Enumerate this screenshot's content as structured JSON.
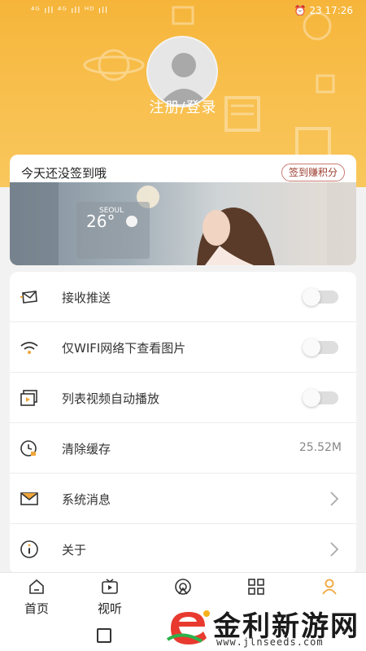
{
  "status": {
    "left": "⁴ᴳ ıll ⁴ᴳ ıll ᴴᴰ ıll",
    "right": "⏰ 23 17:26"
  },
  "profile": {
    "login_text": "注册/登录"
  },
  "checkin": {
    "text": "今天还没签到哦",
    "button": "签到赚积分",
    "banner": {
      "city": "SEOUL",
      "temp": "26°"
    }
  },
  "settings": [
    {
      "label": "接收推送",
      "icon": "envelope-send-icon",
      "control": "toggle"
    },
    {
      "label": "仅WIFI网络下查看图片",
      "icon": "wifi-icon",
      "control": "toggle"
    },
    {
      "label": "列表视频自动播放",
      "icon": "video-play-icon",
      "control": "toggle"
    },
    {
      "label": "清除缓存",
      "icon": "clock-clear-icon",
      "control": "value",
      "value": "25.52M"
    },
    {
      "label": "系统消息",
      "icon": "mail-icon",
      "control": "chevron"
    },
    {
      "label": "关于",
      "icon": "info-icon",
      "control": "chevron"
    }
  ],
  "tabs": [
    {
      "label": "首页",
      "icon": "home-icon"
    },
    {
      "label": "视听",
      "icon": "tv-icon"
    },
    {
      "label": "",
      "icon": "broadcast-icon"
    },
    {
      "label": "",
      "icon": "grid-icon"
    },
    {
      "label": "",
      "icon": "profile-icon"
    }
  ],
  "colors": {
    "header": "#f6b53a",
    "accent": "#f0a63a",
    "checkin_border": "#c97a72"
  },
  "watermark": {
    "title": "金利新游网",
    "url": "www.jlnseeds.com"
  }
}
